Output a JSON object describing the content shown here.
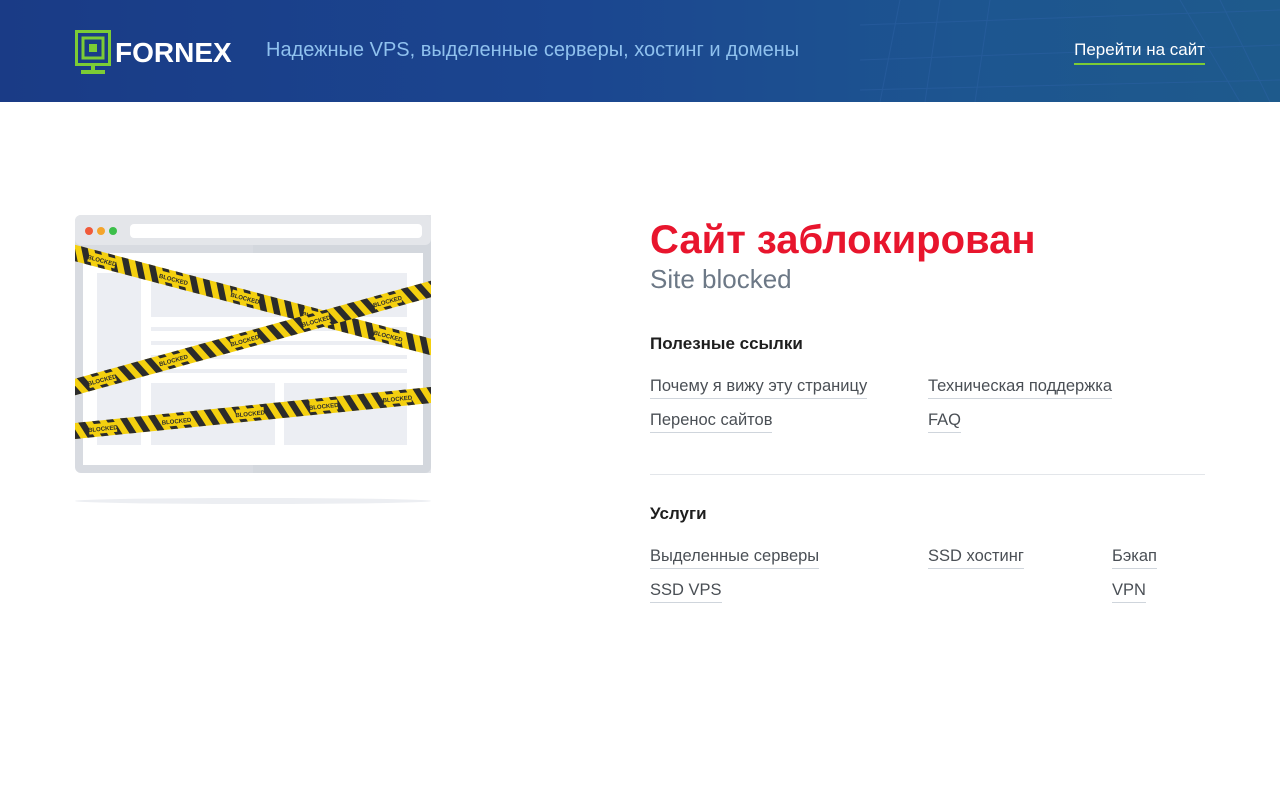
{
  "header": {
    "logo_text": "FORNEX",
    "tagline": "Надежные VPS, выделенные серверы, хостинг и домены",
    "goto_label": "Перейти на сайт"
  },
  "illustration": {
    "tape_label": "BLOCKED"
  },
  "main": {
    "title": "Сайт заблокирован",
    "subtitle": "Site blocked",
    "useful_links": {
      "heading": "Полезные ссылки",
      "items": [
        "Почему я вижу эту страницу",
        "Техническая поддержка",
        "Перенос сайтов",
        "FAQ"
      ]
    },
    "services": {
      "heading": "Услуги",
      "items": [
        "Выделенные серверы",
        "SSD хостинг",
        "Бэкап",
        "SSD VPS",
        "VPN"
      ]
    }
  },
  "colors": {
    "header_bg": "#1b4690",
    "accent_green": "#7ccc35",
    "title_red": "#e8152d",
    "tape_yellow": "#f4d00f"
  }
}
